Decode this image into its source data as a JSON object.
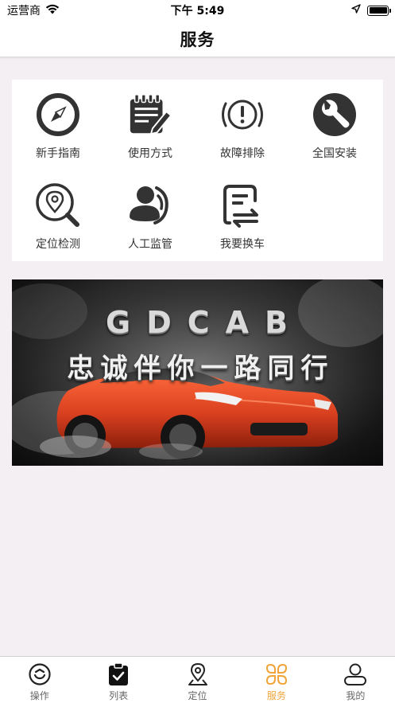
{
  "status_bar": {
    "carrier": "运营商",
    "time": "下午 5:49"
  },
  "nav": {
    "title": "服务"
  },
  "services": [
    {
      "label": "新手指南",
      "icon": "compass-icon"
    },
    {
      "label": "使用方式",
      "icon": "notepad-pen-icon"
    },
    {
      "label": "故障排除",
      "icon": "warning-circle-icon"
    },
    {
      "label": "全国安装",
      "icon": "wrench-icon"
    },
    {
      "label": "定位检测",
      "icon": "location-search-icon"
    },
    {
      "label": "人工监管",
      "icon": "person-support-icon"
    },
    {
      "label": "我要换车",
      "icon": "document-swap-icon"
    }
  ],
  "banner": {
    "brand": "GDCAB",
    "slogan": "忠诚伴你一路同行"
  },
  "tabs": [
    {
      "label": "操作",
      "icon": "operation-icon",
      "active": false
    },
    {
      "label": "列表",
      "icon": "checklist-icon",
      "active": false
    },
    {
      "label": "定位",
      "icon": "location-pin-icon",
      "active": false
    },
    {
      "label": "服务",
      "icon": "service-grid-icon",
      "active": true
    },
    {
      "label": "我的",
      "icon": "profile-icon",
      "active": false
    }
  ],
  "colors": {
    "accent": "#f0a43a",
    "icon_dark": "#333333",
    "background": "#f3eff3",
    "banner_car": "#d9401f"
  }
}
